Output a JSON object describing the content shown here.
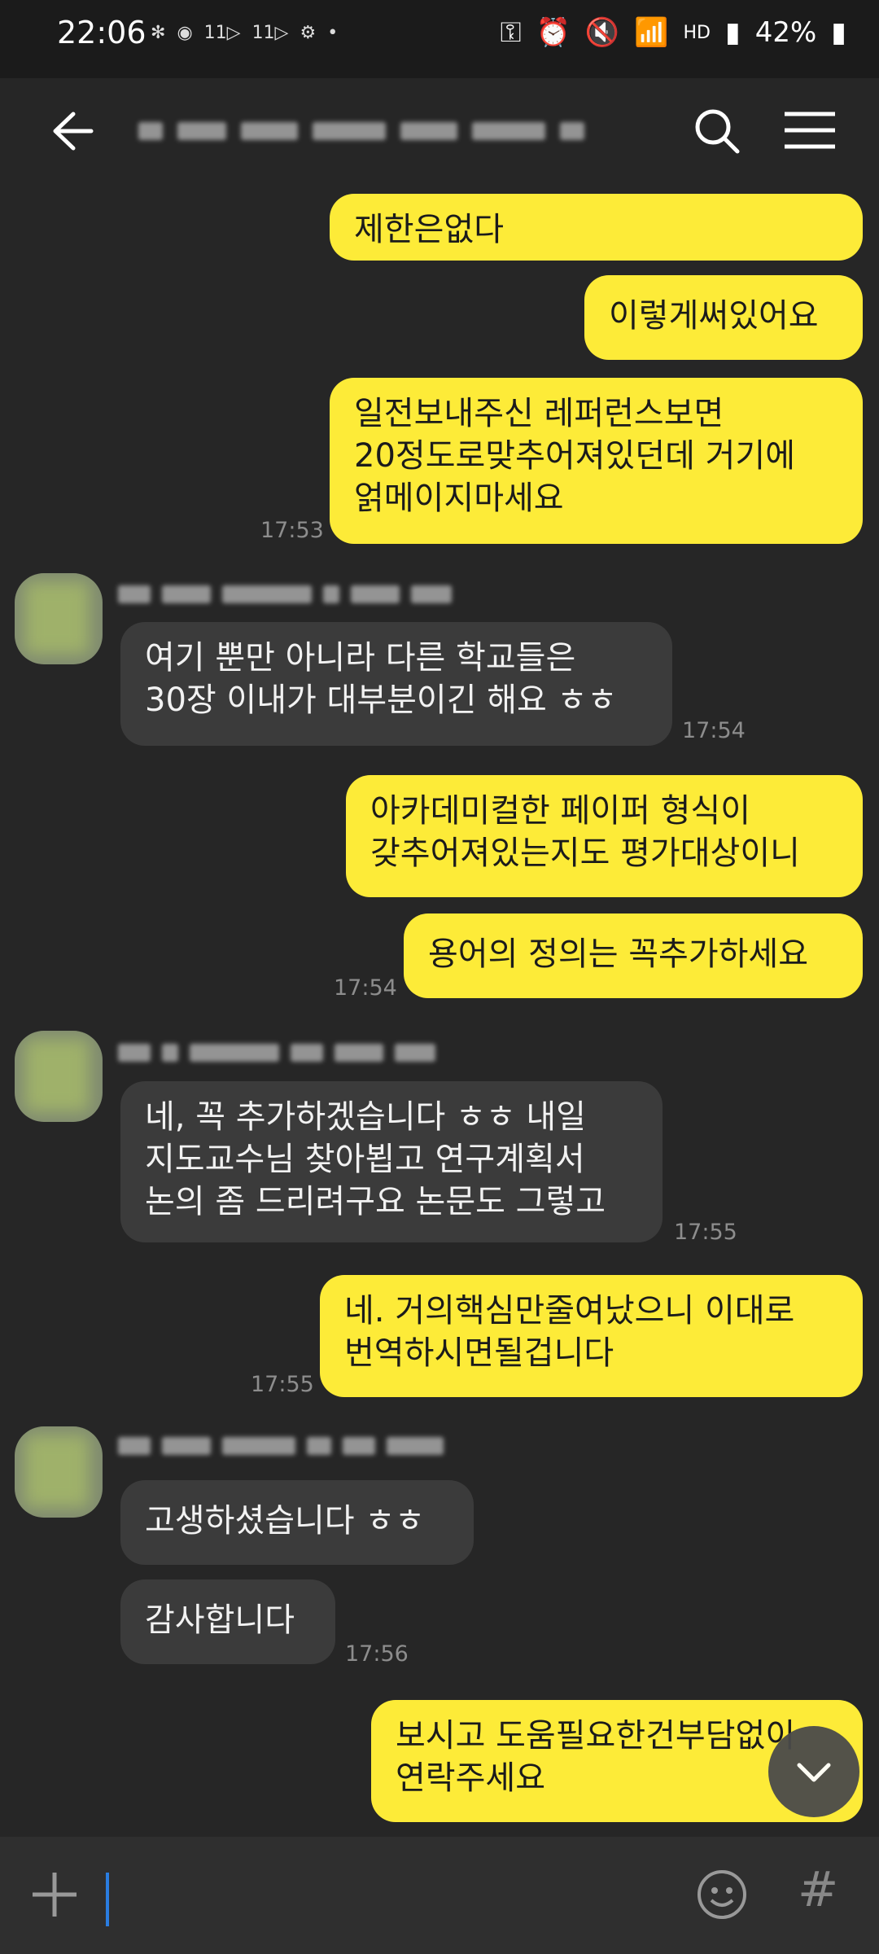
{
  "status_bar": {
    "time": "22:06",
    "left_icons": [
      "network-icon",
      "talk-icon",
      "11-icon",
      "11-icon",
      "settings-icon",
      "dot-icon"
    ],
    "battery": "42%",
    "hd_label": "HD"
  },
  "appbar": {
    "title_hidden": true
  },
  "messages": {
    "m1": "제한은없다",
    "m2": "이렇게써있어요",
    "m3": "일전보내주신 레퍼런스보면\n20정도로맞추어져있던데 거기에\n얽메이지마세요",
    "t1": "17:53",
    "m4": "여기 뿐만 아니라 다른 학교들은\n30장 이내가 대부분이긴 해요 ㅎㅎ",
    "t2": "17:54",
    "m5": "아카데미컬한 페이퍼 형식이\n갖추어져있는지도 평가대상이니",
    "m6": "용어의 정의는 꼭추가하세요",
    "t3": "17:54",
    "m7": "네, 꼭 추가하겠습니다 ㅎㅎ 내일\n지도교수님 찾아뵙고 연구계획서\n논의 좀 드리려구요 논문도 그렇고",
    "t4": "17:55",
    "m8": "네. 거의핵심만줄여났으니 이대로\n번역하시면될겁니다",
    "t5": "17:55",
    "m9": "고생하셨습니다 ㅎㅎ",
    "m10": "감사합니다",
    "t6": "17:56",
    "m11": "보시고 도움필요한건부담없이\n연락주세요"
  },
  "input": {
    "hash": "#"
  },
  "colors": {
    "background": "#262626",
    "mine_bubble": "#fdeb38",
    "other_bubble": "#3b3b3b",
    "cursor": "#2a7de1"
  }
}
